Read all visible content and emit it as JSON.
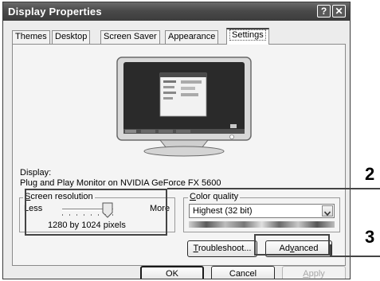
{
  "window": {
    "title": "Display Properties",
    "help_glyph": "?",
    "close_glyph": "✕"
  },
  "tabs": [
    {
      "label": "Themes",
      "active": false
    },
    {
      "label": "Desktop",
      "active": false
    },
    {
      "label": "Screen Saver",
      "active": false
    },
    {
      "label": "Appearance",
      "active": false
    },
    {
      "label": "Settings",
      "active": true
    }
  ],
  "display": {
    "label": "Display:",
    "device": "Plug and Play Monitor on NVIDIA GeForce FX 5600"
  },
  "resolution": {
    "group_prefix": "",
    "group_access": "S",
    "group_rest": "creen resolution",
    "less": "Less",
    "more": "More",
    "value": "1280 by 1024 pixels",
    "slider_fraction": 1.0
  },
  "color": {
    "group_access": "C",
    "group_rest": "olor quality",
    "selected": "Highest (32 bit)"
  },
  "buttons": {
    "troubleshoot_access": "T",
    "troubleshoot_rest": "roubleshoot...",
    "advanced_pre": "Ad",
    "advanced_access": "v",
    "advanced_rest": "anced",
    "ok": "OK",
    "cancel": "Cancel",
    "apply_access": "A",
    "apply_rest": "pply"
  },
  "callouts": [
    {
      "label": "2"
    },
    {
      "label": "3"
    }
  ],
  "colors": {
    "titlebar": "#4a4a4a",
    "face": "#ececec",
    "screen": "#222222"
  }
}
